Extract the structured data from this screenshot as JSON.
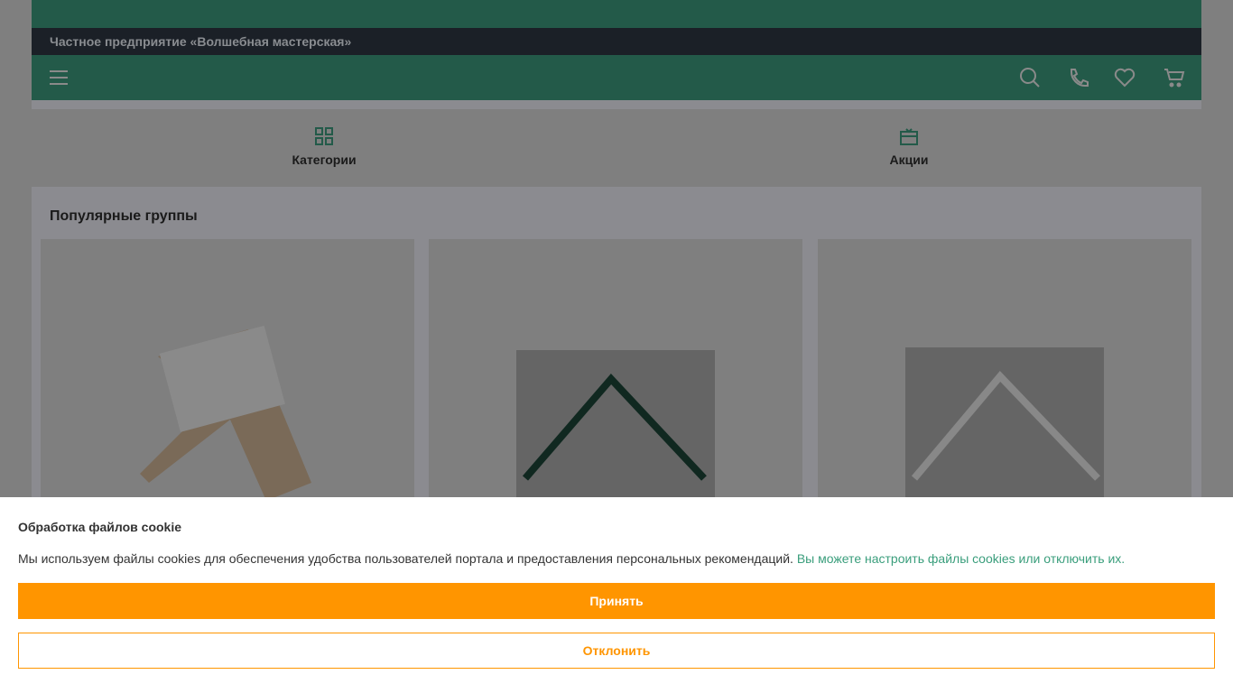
{
  "header": {
    "company": "Частное предприятие «Волшебная мастерская»"
  },
  "tabs": [
    {
      "label": "Категории",
      "icon": "grid-icon"
    },
    {
      "label": "Акции",
      "icon": "gift-icon"
    }
  ],
  "section": {
    "title": "Популярные группы"
  },
  "cookie": {
    "title": "Обработка файлов cookie",
    "text": "Мы используем файлы cookies для обеспечения удобства пользователей портала и предоставления персональных рекомендаций.",
    "link": "Вы можете настроить файлы cookies или отключить их.",
    "accept": "Принять",
    "decline": "Отклонить"
  },
  "colors": {
    "accent": "#ff9500",
    "brand": "#3a9e7c"
  }
}
